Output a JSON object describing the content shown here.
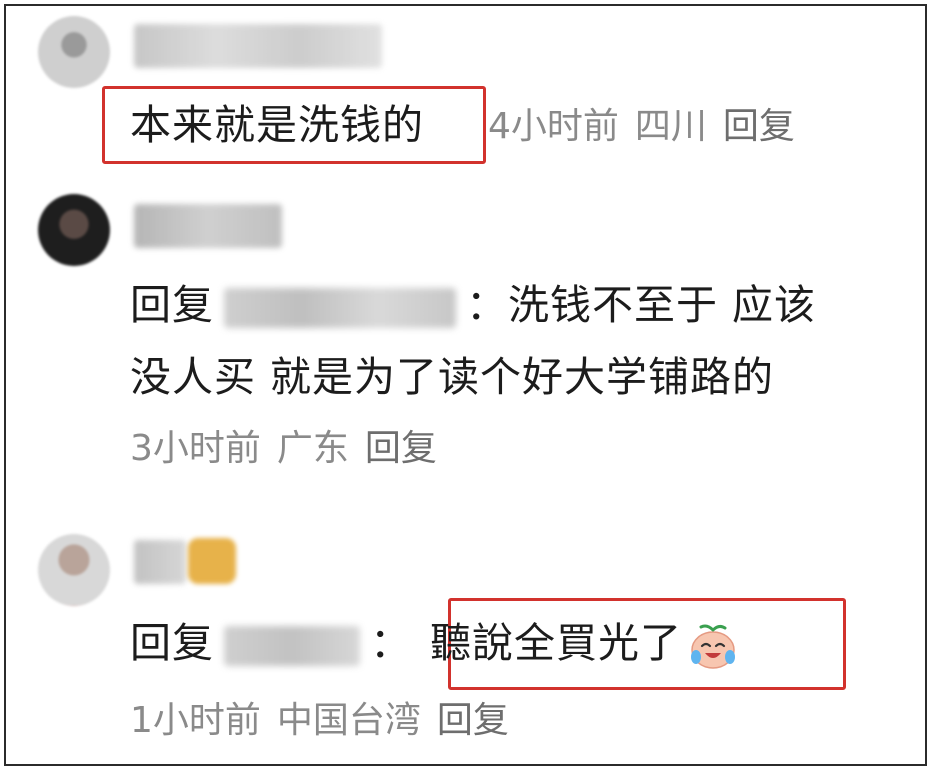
{
  "comments": [
    {
      "text": "本来就是洗钱的",
      "meta": {
        "time": "4小时前",
        "location": "四川",
        "reply": "回复"
      }
    },
    {
      "reply_prefix": "回复",
      "text_line1": "：洗钱不至于 应该",
      "text_line2": "没人买 就是为了读个好大学铺路的",
      "meta": {
        "time": "3小时前",
        "location": "广东",
        "reply": "回复"
      }
    },
    {
      "reply_prefix": "回复",
      "colon": "：",
      "text": "聽說全買光了",
      "emoji": "crying-laugh-emoji",
      "meta": {
        "time": "1小时前",
        "location": "中国台湾",
        "reply": "回复"
      }
    }
  ],
  "colors": {
    "highlight": "#d2322d",
    "meta_text": "#8a8a8a",
    "body_text": "#1c1c1c"
  }
}
